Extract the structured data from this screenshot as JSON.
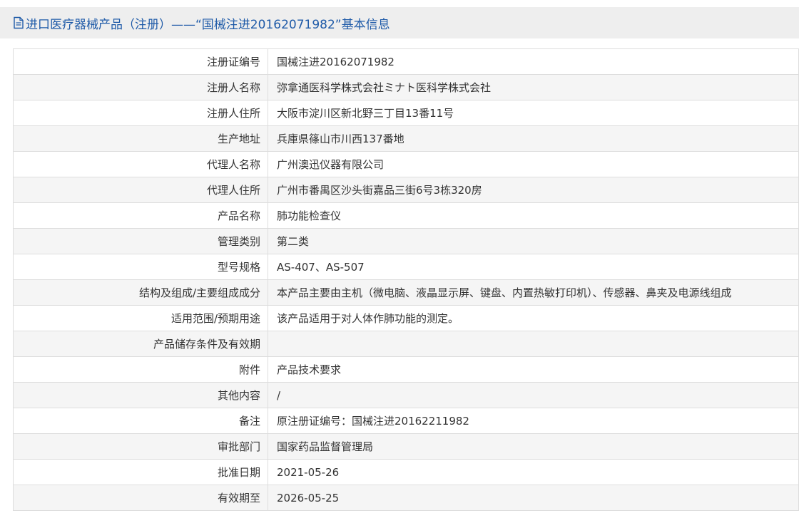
{
  "header": {
    "icon": "document-icon",
    "title": "进口医疗器械产品（注册）——“国械注进20162071982”基本信息"
  },
  "rows": [
    {
      "label": "注册证编号",
      "value": "国械注进20162071982"
    },
    {
      "label": "注册人名称",
      "value": "弥拿通医科学株式会社ミナト医科学株式会社"
    },
    {
      "label": "注册人住所",
      "value": "大阪市淀川区新北野三丁目13番11号"
    },
    {
      "label": "生产地址",
      "value": "兵庫県篠山市川西137番地"
    },
    {
      "label": "代理人名称",
      "value": "广州澳迅仪器有限公司"
    },
    {
      "label": "代理人住所",
      "value": "广州市番禺区沙头街嘉品三街6号3栋320房"
    },
    {
      "label": "产品名称",
      "value": "肺功能检查仪"
    },
    {
      "label": "管理类别",
      "value": "第二类"
    },
    {
      "label": "型号规格",
      "value": "AS-407、AS-507"
    },
    {
      "label": "结构及组成/主要组成成分",
      "value": "本产品主要由主机（微电脑、液晶显示屏、键盘、内置热敏打印机）、传感器、鼻夹及电源线组成"
    },
    {
      "label": "适用范围/预期用途",
      "value": "该产品适用于对人体作肺功能的测定。"
    },
    {
      "label": "产品储存条件及有效期",
      "value": ""
    },
    {
      "label": "附件",
      "value": "产品技术要求"
    },
    {
      "label": "其他内容",
      "value": "/"
    },
    {
      "label": "备注",
      "value": "原注册证编号：国械注进20162211982"
    },
    {
      "label": "审批部门",
      "value": "国家药品监督管理局"
    },
    {
      "label": "批准日期",
      "value": "2021-05-26"
    },
    {
      "label": "有效期至",
      "value": "2026-05-25"
    }
  ]
}
